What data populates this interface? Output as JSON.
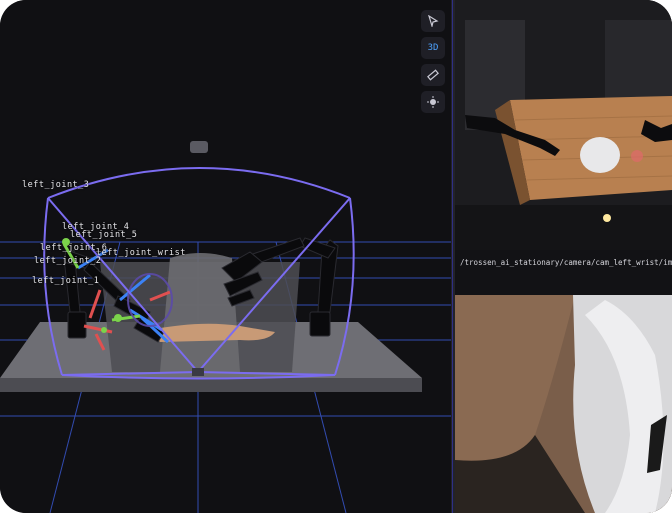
{
  "toolbar": {
    "select_icon": "cursor-arrow-icon",
    "mode_label": "3D",
    "measure_icon": "ruler-icon",
    "center_icon": "target-icon",
    "accent": "#4da3ff"
  },
  "scene": {
    "joint_labels": {
      "joint_3": "left_joint_3",
      "joint_4": "left_joint_4",
      "joint_5": "left_joint_5",
      "joint_6": "left_joint_6",
      "wrist": "left_joint_wrist",
      "joint_2": "left_joint_2",
      "joint_1": "left_joint_1"
    },
    "frustum_color": "#7b6cf0",
    "grid_color": "#3b5bd9"
  },
  "camera_path": "/trossen_ai_stationary/camera/cam_left_wrist/ima..."
}
